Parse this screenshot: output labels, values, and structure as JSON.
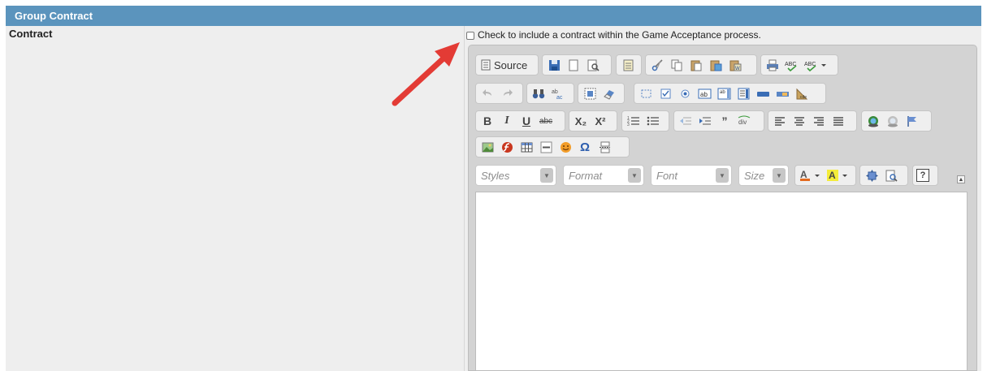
{
  "section": {
    "title": "Group Contract"
  },
  "contract": {
    "label": "Contract"
  },
  "include_checkbox": {
    "label": "Check to include a contract within the Game Acceptance process.",
    "checked": false
  },
  "toolbar": {
    "source_label": "Source",
    "bold": "B",
    "italic": "I",
    "underline": "U",
    "strike": "abc",
    "subscript": "X₂",
    "superscript": "X²",
    "omega": "Ω",
    "spell": "ABC",
    "about": "?"
  },
  "combos": {
    "styles": "Styles",
    "format": "Format",
    "font": "Font",
    "size": "Size"
  },
  "colors": {
    "header_bg": "#5b94bd",
    "panel_bg": "#eeeeee",
    "annotation_arrow": "#e33b35"
  }
}
